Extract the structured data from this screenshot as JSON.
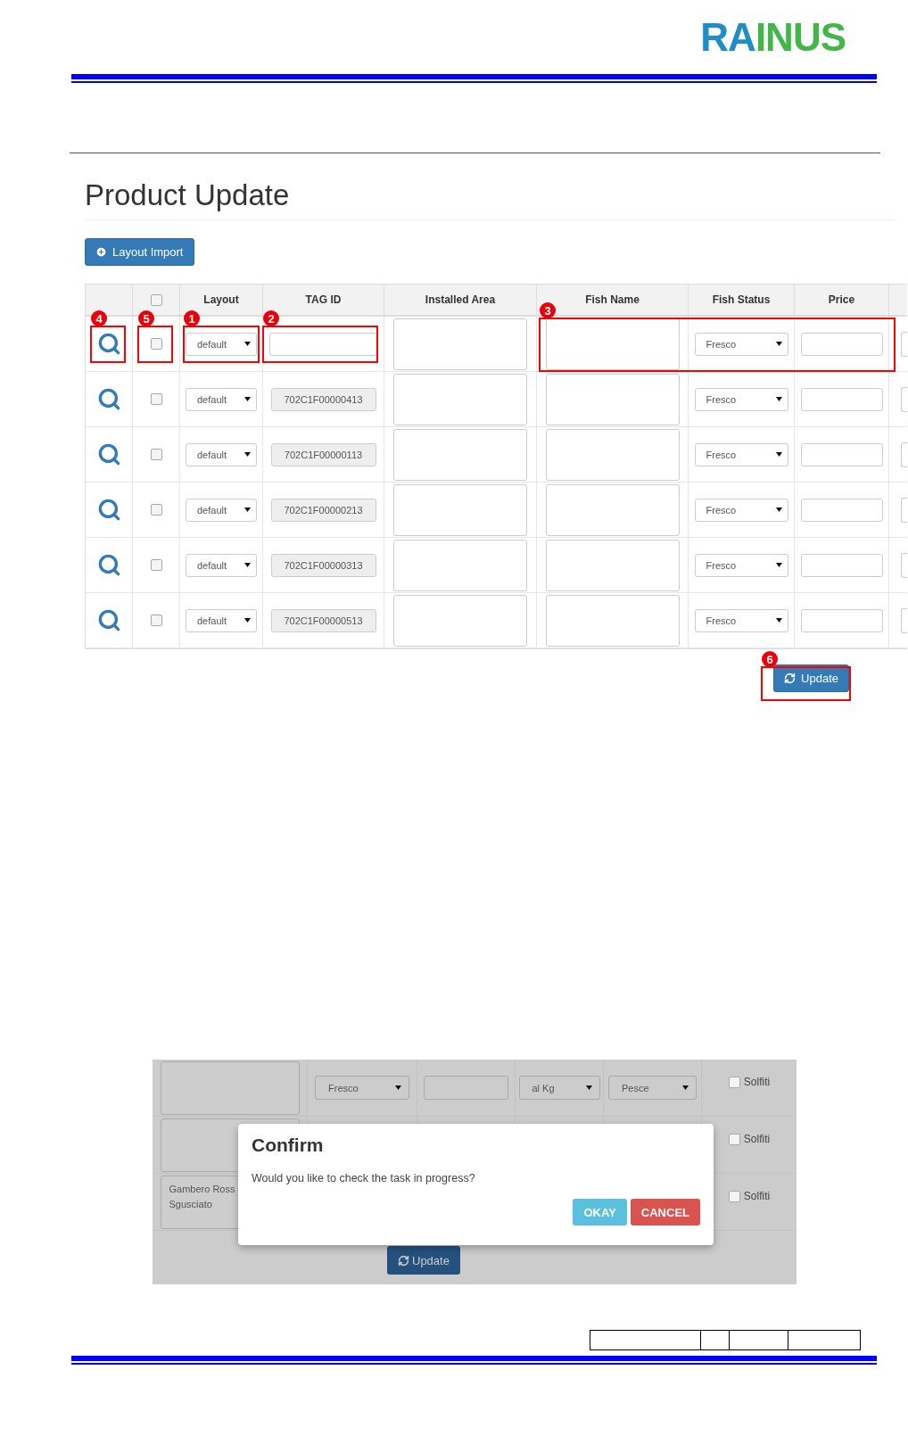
{
  "logo": [
    {
      "text": "RA",
      "color": "#1f8dc6"
    },
    {
      "text": "INUS",
      "color": "#43b649"
    }
  ],
  "page_title": "Product Update",
  "import_button": {
    "label": "Layout Import"
  },
  "table": {
    "columns": [
      {
        "kind": "blank"
      },
      {
        "kind": "checkbox",
        "checked": false
      },
      {
        "kind": "label",
        "label": "Layout"
      },
      {
        "kind": "label",
        "label": "TAG ID"
      },
      {
        "kind": "label",
        "label": "Installed Area"
      },
      {
        "kind": "label",
        "label": "Fish Name"
      },
      {
        "kind": "label",
        "label": "Fish Status"
      },
      {
        "kind": "label",
        "label": "Price"
      }
    ],
    "rows": [
      {
        "checked": false,
        "layout": "default",
        "tag_readonly": false,
        "fish_status": "Fresco"
      },
      {
        "checked": false,
        "layout": "default",
        "tag_id": "702C1F00000413",
        "tag_readonly": true,
        "fish_status": "Fresco"
      },
      {
        "checked": false,
        "layout": "default",
        "tag_id": "702C1F00000113",
        "tag_readonly": true,
        "fish_status": "Fresco"
      },
      {
        "checked": false,
        "layout": "default",
        "tag_id": "702C1F00000213",
        "tag_readonly": true,
        "fish_status": "Fresco"
      },
      {
        "checked": false,
        "layout": "default",
        "tag_id": "702C1F00000313",
        "tag_readonly": true,
        "fish_status": "Fresco"
      },
      {
        "checked": false,
        "layout": "default",
        "tag_id": "702C1F00000513",
        "tag_readonly": true,
        "fish_status": "Fresco"
      }
    ]
  },
  "update_button": {
    "label": "Update"
  },
  "callouts": [
    {
      "label": "1",
      "kind": "layout"
    },
    {
      "label": "2",
      "kind": "tagid"
    },
    {
      "label": "3",
      "kind": "fish"
    },
    {
      "label": "4",
      "kind": "search"
    },
    {
      "label": "5",
      "kind": "checkbox"
    },
    {
      "label": "6",
      "kind": "update"
    }
  ],
  "dialog_screenshot": {
    "rows": [
      {
        "fish_status": "Fresco",
        "unit": "al Kg",
        "category": "Pesce",
        "option": "Solfiti",
        "checked": false
      },
      {
        "option": "Solfiti",
        "checked": false
      },
      {
        "fish_name": "Gambero Ross",
        "fish_name_line2": "Sgusciato",
        "option": "Solfiti",
        "checked": false
      }
    ],
    "update_button": "Update",
    "dialog": {
      "title": "Confirm",
      "message": "Would you like to check the task in progress?",
      "buttons": [
        {
          "kind": "confirm",
          "label": "OKAY"
        },
        {
          "kind": "cancel",
          "label": "CANCEL"
        }
      ]
    }
  }
}
